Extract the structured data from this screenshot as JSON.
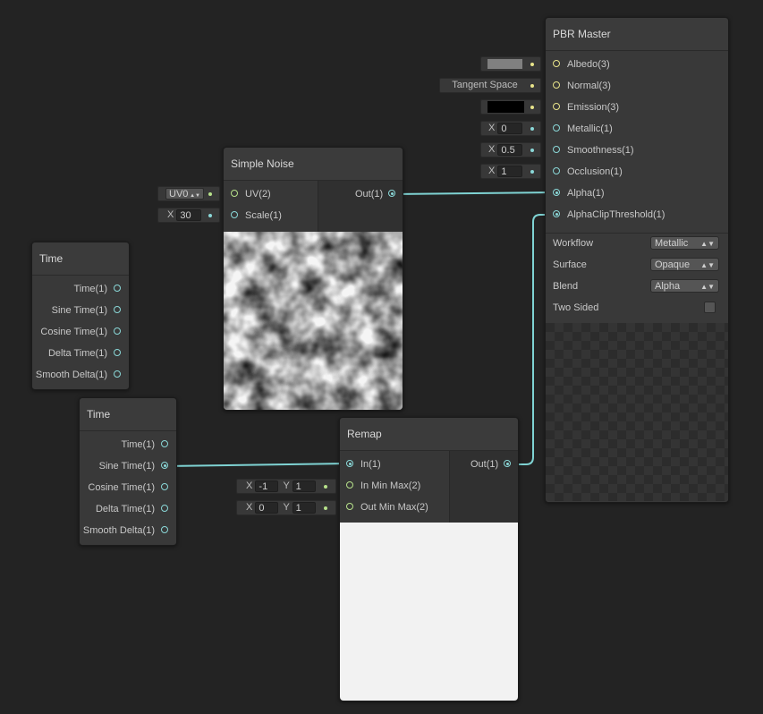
{
  "colors": {
    "background": "#232323",
    "node_body": "#393939",
    "wire": "#7fd3d3",
    "port_float": "#8ad8d8",
    "port_vector3": "#e8e48a",
    "port_vector2": "#b7e28b",
    "albedo_swatch": "#808080",
    "emission_swatch": "#000000",
    "remap_preview": "#f2f2f2"
  },
  "pbr_master": {
    "title": "PBR Master",
    "inputs": [
      {
        "label": "Albedo(3)",
        "type": "vector3"
      },
      {
        "label": "Normal(3)",
        "type": "vector3"
      },
      {
        "label": "Emission(3)",
        "type": "vector3"
      },
      {
        "label": "Metallic(1)",
        "type": "float"
      },
      {
        "label": "Smoothness(1)",
        "type": "float"
      },
      {
        "label": "Occlusion(1)",
        "type": "float"
      },
      {
        "label": "Alpha(1)",
        "type": "float"
      },
      {
        "label": "AlphaClipThreshold(1)",
        "type": "float"
      }
    ],
    "inline_values": {
      "normal_space": "Tangent Space",
      "metallic_axis": "X",
      "metallic_value": "0",
      "smoothness_axis": "X",
      "smoothness_value": "0.5",
      "occlusion_axis": "X",
      "occlusion_value": "1"
    },
    "settings": [
      {
        "label": "Workflow",
        "value": "Metallic"
      },
      {
        "label": "Surface",
        "value": "Opaque"
      },
      {
        "label": "Blend",
        "value": "Alpha"
      }
    ],
    "two_sided_label": "Two Sided",
    "two_sided_checked": false
  },
  "simple_noise": {
    "title": "Simple Noise",
    "inputs": [
      {
        "label": "UV(2)",
        "type": "vector2"
      },
      {
        "label": "Scale(1)",
        "type": "float"
      }
    ],
    "output": "Out(1)",
    "uv_channel": "UV0",
    "scale_axis": "X",
    "scale_value": "30"
  },
  "time_node_1": {
    "title": "Time",
    "outputs": [
      "Time(1)",
      "Sine Time(1)",
      "Cosine Time(1)",
      "Delta Time(1)",
      "Smooth Delta(1)"
    ]
  },
  "time_node_2": {
    "title": "Time",
    "outputs": [
      "Time(1)",
      "Sine Time(1)",
      "Cosine Time(1)",
      "Delta Time(1)",
      "Smooth Delta(1)"
    ]
  },
  "remap": {
    "title": "Remap",
    "inputs": [
      {
        "label": "In(1)",
        "type": "float"
      },
      {
        "label": "In Min Max(2)",
        "type": "vector2"
      },
      {
        "label": "Out Min Max(2)",
        "type": "vector2"
      }
    ],
    "output": "Out(1)",
    "in_min_max": {
      "x_label": "X",
      "x": "-1",
      "y_label": "Y",
      "y": "1"
    },
    "out_min_max": {
      "x_label": "X",
      "x": "0",
      "y_label": "Y",
      "y": "1"
    }
  }
}
